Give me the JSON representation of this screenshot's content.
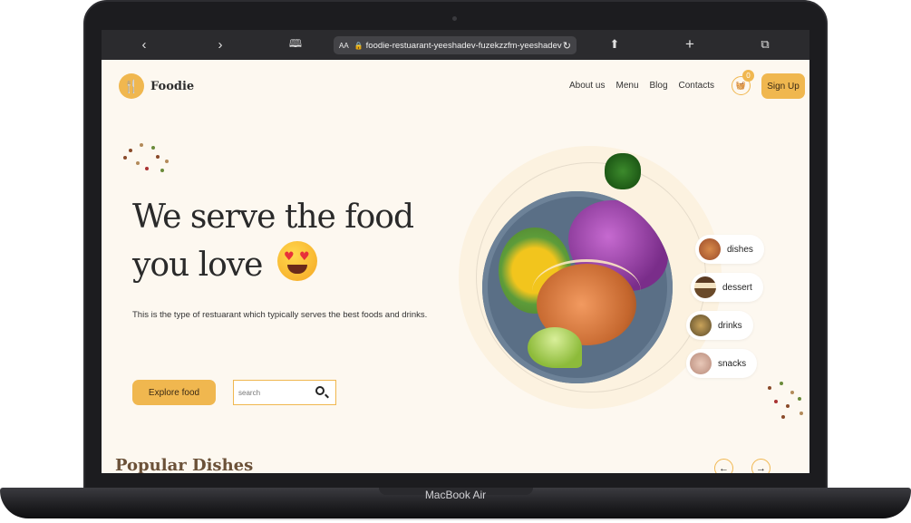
{
  "device": {
    "label": "MacBook Air"
  },
  "browser": {
    "url": "foodie-restuarant-yeeshadev-fuzekzzfm-yeeshadev",
    "aa_label": "AA"
  },
  "site": {
    "brand": "Foodie",
    "nav": [
      "About us",
      "Menu",
      "Blog",
      "Contacts"
    ],
    "cart_count": "0",
    "signup_label": "Sign Up",
    "accent_color": "#f0b74f"
  },
  "hero": {
    "title_line1": "We serve the food",
    "title_line2": "you love",
    "description": "This is the type of restuarant which typically serves the best foods and drinks.",
    "explore_label": "Explore food",
    "search_placeholder": "search"
  },
  "categories": [
    {
      "label": "dishes"
    },
    {
      "label": "dessert"
    },
    {
      "label": "drinks"
    },
    {
      "label": "snacks"
    }
  ],
  "popular": {
    "title": "Popular Dishes"
  }
}
